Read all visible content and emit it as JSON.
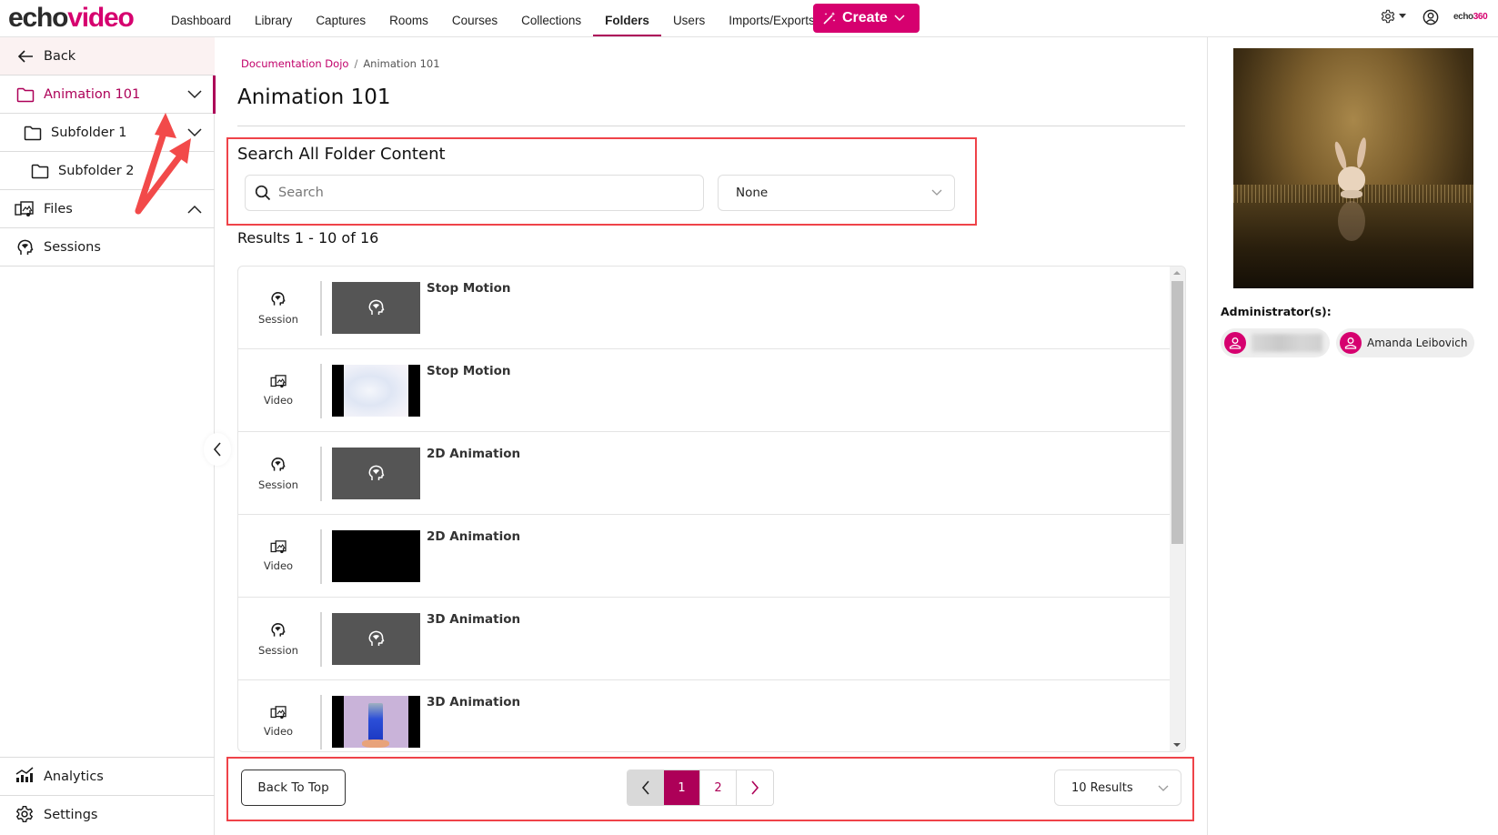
{
  "app": {
    "logo_part1": "echo",
    "logo_part2": "video",
    "brand_small_part1": "echo",
    "brand_small_part2": "360"
  },
  "nav": {
    "items": [
      {
        "label": "Dashboard",
        "active": false
      },
      {
        "label": "Library",
        "active": false
      },
      {
        "label": "Captures",
        "active": false
      },
      {
        "label": "Rooms",
        "active": false
      },
      {
        "label": "Courses",
        "active": false
      },
      {
        "label": "Collections",
        "active": false
      },
      {
        "label": "Folders",
        "active": true
      },
      {
        "label": "Users",
        "active": false
      },
      {
        "label": "Imports/Exports",
        "active": false
      }
    ],
    "create_label": "Create"
  },
  "sidebar": {
    "back_label": "Back",
    "folders": [
      {
        "label": "Animation 101",
        "level": 0,
        "active": true,
        "expandable": true
      },
      {
        "label": "Subfolder 1",
        "level": 1,
        "active": false,
        "expandable": true
      },
      {
        "label": "Subfolder 2",
        "level": 2,
        "active": false,
        "expandable": false
      }
    ],
    "files_label": "Files",
    "sessions_label": "Sessions",
    "analytics_label": "Analytics",
    "settings_label": "Settings"
  },
  "breadcrumb": {
    "parent": "Documentation Dojo",
    "separator": "/",
    "current": "Animation 101"
  },
  "page": {
    "title": "Animation 101",
    "search_heading": "Search All Folder Content",
    "search_placeholder": "Search",
    "search_value": "",
    "filter_selected": "None",
    "results_text": "Results 1 - 10 of 16"
  },
  "items": [
    {
      "type": "Session",
      "title": "Stop Motion",
      "thumb": "session"
    },
    {
      "type": "Video",
      "title": "Stop Motion",
      "thumb": "video-light"
    },
    {
      "type": "Session",
      "title": "2D Animation",
      "thumb": "session"
    },
    {
      "type": "Video",
      "title": "2D Animation",
      "thumb": "video-black"
    },
    {
      "type": "Session",
      "title": "3D Animation",
      "thumb": "session"
    },
    {
      "type": "Video",
      "title": "3D Animation",
      "thumb": "video-purple"
    }
  ],
  "pager": {
    "back_to_top": "Back To Top",
    "pages": [
      "1",
      "2"
    ],
    "current_page": "1",
    "per_page": "10 Results"
  },
  "right_panel": {
    "admin_label": "Administrator(s):",
    "admins": [
      {
        "name": "",
        "blurred": true
      },
      {
        "name": "Amanda Leibovich",
        "blurred": false
      }
    ]
  },
  "colors": {
    "brand": "#d6006f",
    "accent": "#ad0058",
    "highlight": "#ef4349"
  }
}
